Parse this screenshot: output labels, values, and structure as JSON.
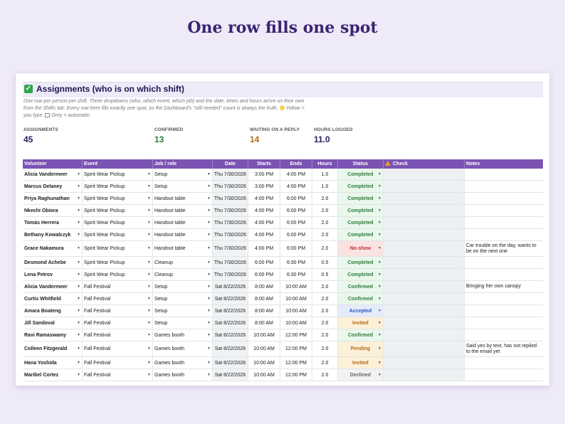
{
  "page_title": "One row fills one spot",
  "header": {
    "title": "Assignments  (who is on which shift)",
    "subtitle_1": "One row per person per shift. Three dropdowns (who, which event, which job) and the date, times and hours arrive on their own from the Shifts tab. Every row here fills exactly one spot, so the Dashboard's \"still needed\" count is always the truth.",
    "subtitle_2": "Yellow = you type.",
    "subtitle_3": "Grey = automatic."
  },
  "kpis": [
    {
      "label": "ASSIGNMENTS",
      "value": "45",
      "color": "#2b1b5e"
    },
    {
      "label": "CONFIRMED",
      "value": "13",
      "color": "#2e7d3e"
    },
    {
      "label": "WAITING ON A REPLY",
      "value": "14",
      "color": "#b46a12"
    },
    {
      "label": "HOURS LOGGED",
      "value": "11.0",
      "color": "#2b1b5e"
    }
  ],
  "columns": [
    "Volunteer",
    "Event",
    "Job / role",
    "Date",
    "Starts",
    "Ends",
    "Hours",
    "Status",
    "Check",
    "Notes"
  ],
  "colors": {
    "header_bg": "#7a53b3",
    "accent": "#3a2472"
  },
  "rows": [
    {
      "volunteer": "Alicia Vandermeer",
      "event": "Spirit Wear Pickup",
      "job": "Setup",
      "date": "Thu 7/30/2026",
      "starts": "3:00 PM",
      "ends": "4:00 PM",
      "hours": "1.0",
      "status": "Completed",
      "check": "",
      "notes": ""
    },
    {
      "volunteer": "Marcus Delaney",
      "event": "Spirit Wear Pickup",
      "job": "Setup",
      "date": "Thu 7/30/2026",
      "starts": "3:00 PM",
      "ends": "4:00 PM",
      "hours": "1.0",
      "status": "Completed",
      "check": "",
      "notes": ""
    },
    {
      "volunteer": "Priya Raghunathan",
      "event": "Spirit Wear Pickup",
      "job": "Handout table",
      "date": "Thu 7/30/2026",
      "starts": "4:00 PM",
      "ends": "6:00 PM",
      "hours": "2.0",
      "status": "Completed",
      "check": "",
      "notes": ""
    },
    {
      "volunteer": "Nkechi Obiora",
      "event": "Spirit Wear Pickup",
      "job": "Handout table",
      "date": "Thu 7/30/2026",
      "starts": "4:00 PM",
      "ends": "6:00 PM",
      "hours": "2.0",
      "status": "Completed",
      "check": "",
      "notes": ""
    },
    {
      "volunteer": "Tomás Herrera",
      "event": "Spirit Wear Pickup",
      "job": "Handout table",
      "date": "Thu 7/30/2026",
      "starts": "4:00 PM",
      "ends": "6:00 PM",
      "hours": "2.0",
      "status": "Completed",
      "check": "",
      "notes": ""
    },
    {
      "volunteer": "Bethany Kowalczyk",
      "event": "Spirit Wear Pickup",
      "job": "Handout table",
      "date": "Thu 7/30/2026",
      "starts": "4:00 PM",
      "ends": "6:00 PM",
      "hours": "2.0",
      "status": "Completed",
      "check": "",
      "notes": ""
    },
    {
      "volunteer": "Grace Nakamura",
      "event": "Spirit Wear Pickup",
      "job": "Handout table",
      "date": "Thu 7/30/2026",
      "starts": "4:00 PM",
      "ends": "6:00 PM",
      "hours": "2.0",
      "status": "No-show",
      "check": "",
      "notes": "Car trouble on the day, wants to be on the next one"
    },
    {
      "volunteer": "Desmond Achebe",
      "event": "Spirit Wear Pickup",
      "job": "Cleanup",
      "date": "Thu 7/30/2026",
      "starts": "6:00 PM",
      "ends": "6:30 PM",
      "hours": "0.5",
      "status": "Completed",
      "check": "",
      "notes": ""
    },
    {
      "volunteer": "Lena Petrov",
      "event": "Spirit Wear Pickup",
      "job": "Cleanup",
      "date": "Thu 7/30/2026",
      "starts": "6:00 PM",
      "ends": "6:30 PM",
      "hours": "0.5",
      "status": "Completed",
      "check": "",
      "notes": ""
    },
    {
      "volunteer": "Alicia Vandermeer",
      "event": "Fall Festival",
      "job": "Setup",
      "date": "Sat 8/22/2026",
      "starts": "8:00 AM",
      "ends": "10:00 AM",
      "hours": "2.0",
      "status": "Confirmed",
      "check": "",
      "notes": "Bringing her own canopy"
    },
    {
      "volunteer": "Curtis Whitfield",
      "event": "Fall Festival",
      "job": "Setup",
      "date": "Sat 8/22/2026",
      "starts": "8:00 AM",
      "ends": "10:00 AM",
      "hours": "2.0",
      "status": "Confirmed",
      "check": "",
      "notes": ""
    },
    {
      "volunteer": "Amara Boateng",
      "event": "Fall Festival",
      "job": "Setup",
      "date": "Sat 8/22/2026",
      "starts": "8:00 AM",
      "ends": "10:00 AM",
      "hours": "2.0",
      "status": "Accepted",
      "check": "",
      "notes": ""
    },
    {
      "volunteer": "Jill Sandoval",
      "event": "Fall Festival",
      "job": "Setup",
      "date": "Sat 8/22/2026",
      "starts": "8:00 AM",
      "ends": "10:00 AM",
      "hours": "2.0",
      "status": "Invited",
      "check": "",
      "notes": ""
    },
    {
      "volunteer": "Ravi Ramaswamy",
      "event": "Fall Festival",
      "job": "Games booth",
      "date": "Sat 8/22/2026",
      "starts": "10:00 AM",
      "ends": "12:00 PM",
      "hours": "2.0",
      "status": "Confirmed",
      "check": "",
      "notes": ""
    },
    {
      "volunteer": "Colleen Fitzgerald",
      "event": "Fall Festival",
      "job": "Games booth",
      "date": "Sat 8/22/2026",
      "starts": "10:00 AM",
      "ends": "12:00 PM",
      "hours": "2.0",
      "status": "Pending",
      "check": "",
      "notes": "Said yes by text, has not replied to the email yet"
    },
    {
      "volunteer": "Hana Yoshida",
      "event": "Fall Festival",
      "job": "Games booth",
      "date": "Sat 8/22/2026",
      "starts": "10:00 AM",
      "ends": "12:00 PM",
      "hours": "2.0",
      "status": "Invited",
      "check": "",
      "notes": ""
    },
    {
      "volunteer": "Maribel Cortez",
      "event": "Fall Festival",
      "job": "Games booth",
      "date": "Sat 8/22/2026",
      "starts": "10:00 AM",
      "ends": "12:00 PM",
      "hours": "2.0",
      "status": "Declined",
      "check": "",
      "notes": ""
    }
  ]
}
